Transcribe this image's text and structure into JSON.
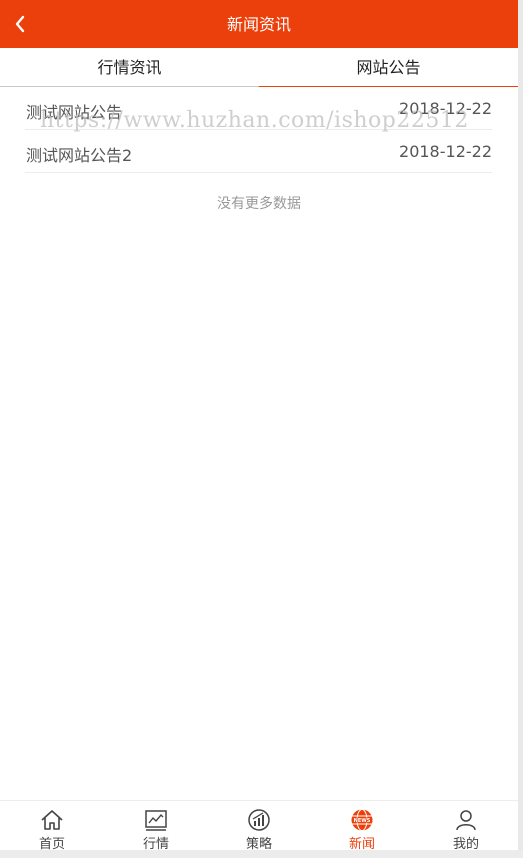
{
  "header": {
    "title": "新闻资讯",
    "back_icon": "chevron-left-icon"
  },
  "tabs": [
    {
      "label": "行情资讯",
      "active": false
    },
    {
      "label": "网站公告",
      "active": true
    }
  ],
  "list": [
    {
      "title": "测试网站公告",
      "date": "2018-12-22"
    },
    {
      "title": "测试网站公告2",
      "date": "2018-12-22"
    }
  ],
  "no_more_text": "没有更多数据",
  "watermark": "https://www.huzhan.com/ishop22512",
  "tabbar": [
    {
      "label": "首页",
      "icon": "home-icon",
      "active": false
    },
    {
      "label": "行情",
      "icon": "chart-icon",
      "active": false
    },
    {
      "label": "策略",
      "icon": "strategy-icon",
      "active": false
    },
    {
      "label": "新闻",
      "icon": "news-globe-icon",
      "active": true
    },
    {
      "label": "我的",
      "icon": "user-icon",
      "active": false
    }
  ],
  "colors": {
    "accent": "#ec400c",
    "text": "#555555",
    "muted": "#999999"
  }
}
